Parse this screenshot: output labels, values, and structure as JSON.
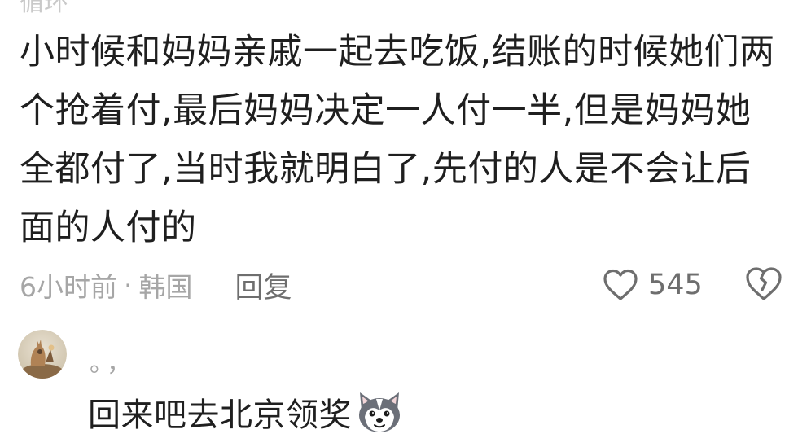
{
  "comment": {
    "cut_header": "循环",
    "body": "小时候和妈妈亲戚一起去吃饭,结账的时候她们两个抢着付,最后妈妈决定一人付一半,但是妈妈她全都付了,当时我就明白了,先付的人是不会让后面的人付的",
    "time": "6小时前",
    "separator": "·",
    "region": "韩国",
    "reply_label": "回复",
    "like_count": "545",
    "like_icon": "heart-outline-icon",
    "dislike_icon": "broken-heart-icon"
  },
  "reply": {
    "avatar_icon": "avatar-illustration",
    "username": "。，",
    "text": "回来吧去北京领奖",
    "sticker_icon": "husky-dog-sticker"
  }
}
